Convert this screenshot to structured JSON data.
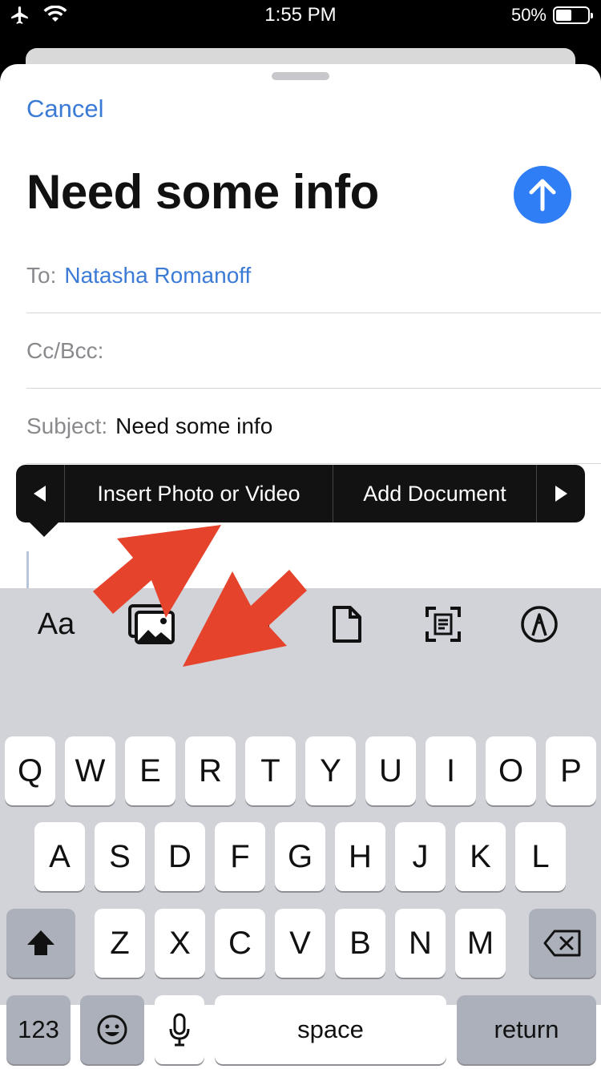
{
  "status_bar": {
    "time": "1:55 PM",
    "battery": "50%",
    "battery_level": 0.5
  },
  "compose": {
    "cancel": "Cancel",
    "title": "Need some info",
    "to_label": "To:",
    "to_value": "Natasha Romanoff",
    "cc_label": "Cc/Bcc:",
    "subject_label": "Subject:",
    "subject_value": "Need some info"
  },
  "callout_menu": {
    "insert_photo": "Insert Photo or Video",
    "add_document": "Add Document"
  },
  "format_bar": {
    "text_format": "Aa"
  },
  "keyboard": {
    "row1": [
      "Q",
      "W",
      "E",
      "R",
      "T",
      "Y",
      "U",
      "I",
      "O",
      "P"
    ],
    "row2": [
      "A",
      "S",
      "D",
      "F",
      "G",
      "H",
      "J",
      "K",
      "L"
    ],
    "row3": [
      "Z",
      "X",
      "C",
      "V",
      "B",
      "N",
      "M"
    ],
    "numbers": "123",
    "space": "space",
    "return": "return"
  },
  "colors": {
    "accent": "#3b7bd6",
    "send": "#2f7ef6",
    "annotation_arrow": "#e5432c"
  }
}
